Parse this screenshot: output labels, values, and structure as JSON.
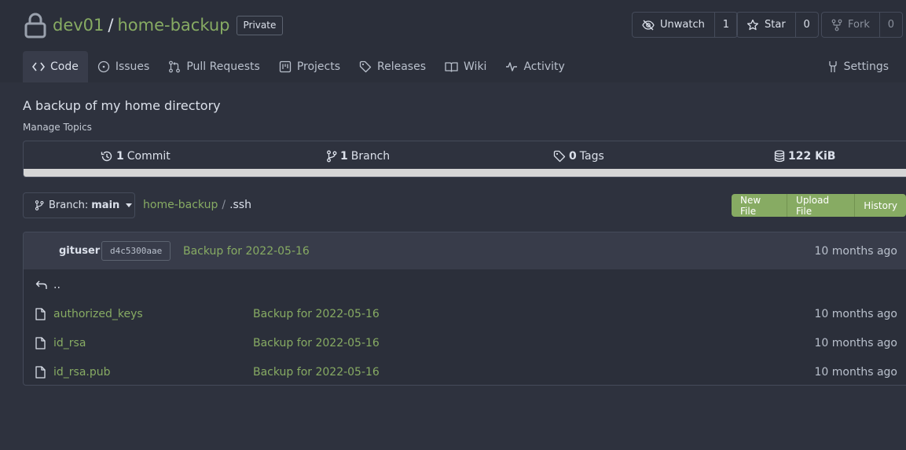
{
  "repo": {
    "owner": "dev01",
    "separator": "/",
    "name": "home-backup",
    "visibility": "Private",
    "description": "A backup of my home directory",
    "manage_topics": "Manage Topics"
  },
  "actions": {
    "unwatch_label": "Unwatch",
    "watch_count": "1",
    "star_label": "Star",
    "star_count": "0",
    "fork_label": "Fork",
    "fork_count": "0"
  },
  "tabs": [
    {
      "label": "Code",
      "icon": "code-icon",
      "active": true
    },
    {
      "label": "Issues",
      "icon": "issue-icon"
    },
    {
      "label": "Pull Requests",
      "icon": "pull-request-icon"
    },
    {
      "label": "Projects",
      "icon": "project-icon"
    },
    {
      "label": "Releases",
      "icon": "tag-icon"
    },
    {
      "label": "Wiki",
      "icon": "book-icon"
    },
    {
      "label": "Activity",
      "icon": "pulse-icon"
    }
  ],
  "settings_label": "Settings",
  "stats": {
    "commits_count": "1",
    "commits_label": "Commit",
    "branches_count": "1",
    "branches_label": "Branch",
    "tags_count": "0",
    "tags_label": "Tags",
    "size": "122 KiB"
  },
  "branch": {
    "prefix": "Branch:",
    "name": "main"
  },
  "breadcrumb": {
    "root": "home-backup",
    "separator": "/",
    "current": ".ssh"
  },
  "file_actions": {
    "new_file": "New File",
    "upload_file": "Upload File",
    "history": "History"
  },
  "latest_commit": {
    "author": "gituser",
    "sha": "d4c5300aae",
    "message": "Backup for 2022-05-16",
    "age": "10 months ago"
  },
  "parent_dir": "..",
  "files": [
    {
      "name": "authorized_keys",
      "message": "Backup for 2022-05-16",
      "age": "10 months ago"
    },
    {
      "name": "id_rsa",
      "message": "Backup for 2022-05-16",
      "age": "10 months ago"
    },
    {
      "name": "id_rsa.pub",
      "message": "Backup for 2022-05-16",
      "age": "10 months ago"
    }
  ],
  "colors": {
    "background": "#2e323e",
    "header": "#2b2f3a",
    "accent_green": "#87ab63",
    "text": "#dbe0ea"
  }
}
